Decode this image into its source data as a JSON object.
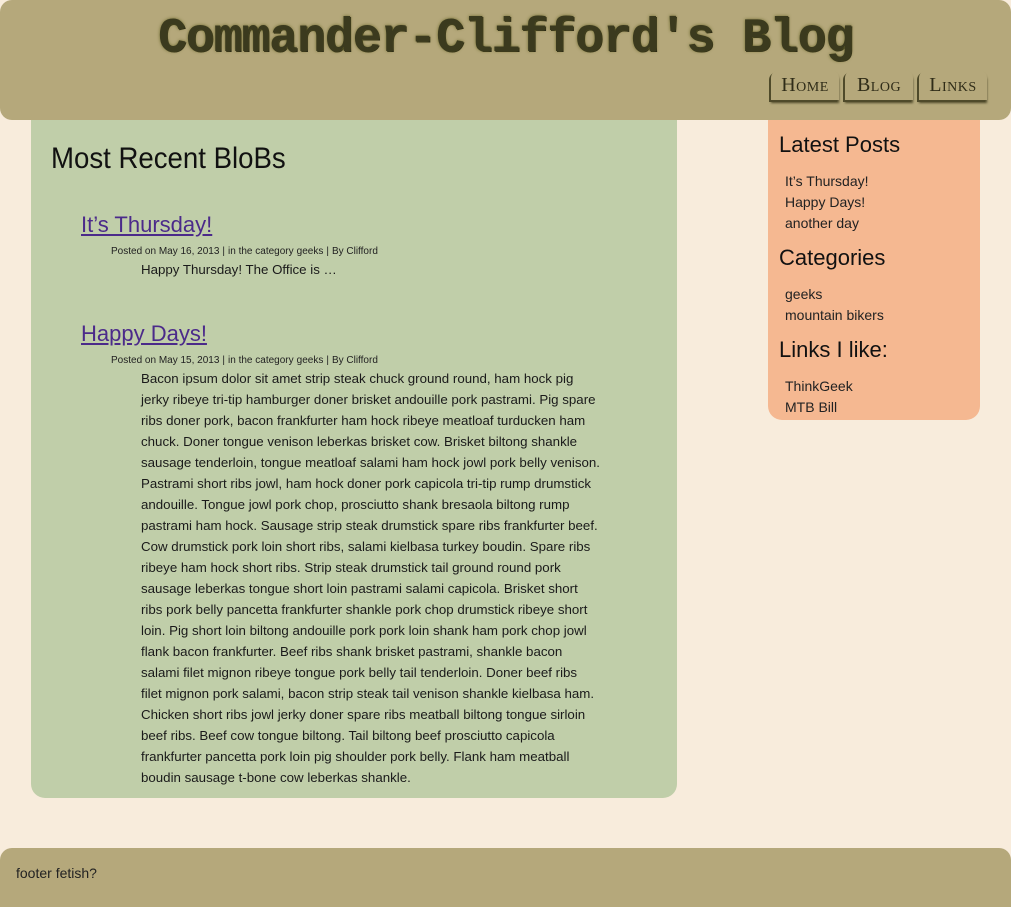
{
  "header": {
    "title": "Commander-Clifford's Blog",
    "nav": [
      "Home",
      "Blog",
      "Links"
    ]
  },
  "main": {
    "heading": "Most Recent BloBs",
    "posts": [
      {
        "title": "It’s Thursday!",
        "meta": {
          "posted_on": "Posted on May 16, 2013",
          "sep1": "|",
          "category_prefix": "in the category",
          "category": "geeks",
          "sep2": "|",
          "author": "By Clifford"
        },
        "body": "Happy Thursday! The Office is …"
      },
      {
        "title": "Happy Days!",
        "meta": {
          "posted_on": "Posted on May 15, 2013",
          "sep1": "|",
          "category_prefix": "in the category",
          "category": "geeks",
          "sep2": "|",
          "author": "By Clifford"
        },
        "body": "Bacon ipsum dolor sit amet strip steak chuck ground round, ham hock pig jerky ribeye tri-tip hamburger doner brisket andouille pork pastrami. Pig spare ribs doner pork, bacon frankfurter ham hock ribeye meatloaf turducken ham chuck. Doner tongue venison leberkas brisket cow. Brisket biltong shankle sausage tenderloin, tongue meatloaf salami ham hock jowl pork belly venison. Pastrami short ribs jowl, ham hock doner pork capicola tri-tip rump drumstick andouille. Tongue jowl pork chop, prosciutto shank bresaola biltong rump pastrami ham hock. Sausage strip steak drumstick spare ribs frankfurter beef. Cow drumstick pork loin short ribs, salami kielbasa turkey boudin. Spare ribs ribeye ham hock short ribs. Strip steak drumstick tail ground round pork sausage leberkas tongue short loin pastrami salami capicola. Brisket short ribs pork belly pancetta frankfurter shankle pork chop drumstick ribeye short loin. Pig short loin biltong andouille pork pork loin shank ham pork chop jowl flank bacon frankfurter. Beef ribs shank brisket pastrami, shankle bacon salami filet mignon ribeye tongue pork belly tail tenderloin. Doner beef ribs filet mignon pork salami, bacon strip steak tail venison shankle kielbasa ham. Chicken short ribs jowl jerky doner spare ribs meatball biltong tongue sirloin beef ribs. Beef cow tongue biltong. Tail biltong beef prosciutto capicola frankfurter pancetta pork loin pig shoulder pork belly. Flank ham meatball boudin sausage t-bone cow leberkas shankle."
      }
    ]
  },
  "sidebar": {
    "latest_heading": "Latest Posts",
    "latest": [
      "It’s Thursday!",
      "Happy Days!",
      "another day"
    ],
    "categories_heading": "Categories",
    "categories": [
      "geeks",
      "mountain bikers"
    ],
    "links_heading": "Links I like:",
    "links": [
      "ThinkGeek",
      "MTB Bill"
    ]
  },
  "footer": {
    "text": "footer fetish?"
  },
  "colors": {
    "page_bg": "#f8ecdc",
    "header_bg": "#b5a87b",
    "main_bg": "#c0cea9",
    "sidebar_bg": "#f5b891",
    "link": "#4b2a8a"
  }
}
